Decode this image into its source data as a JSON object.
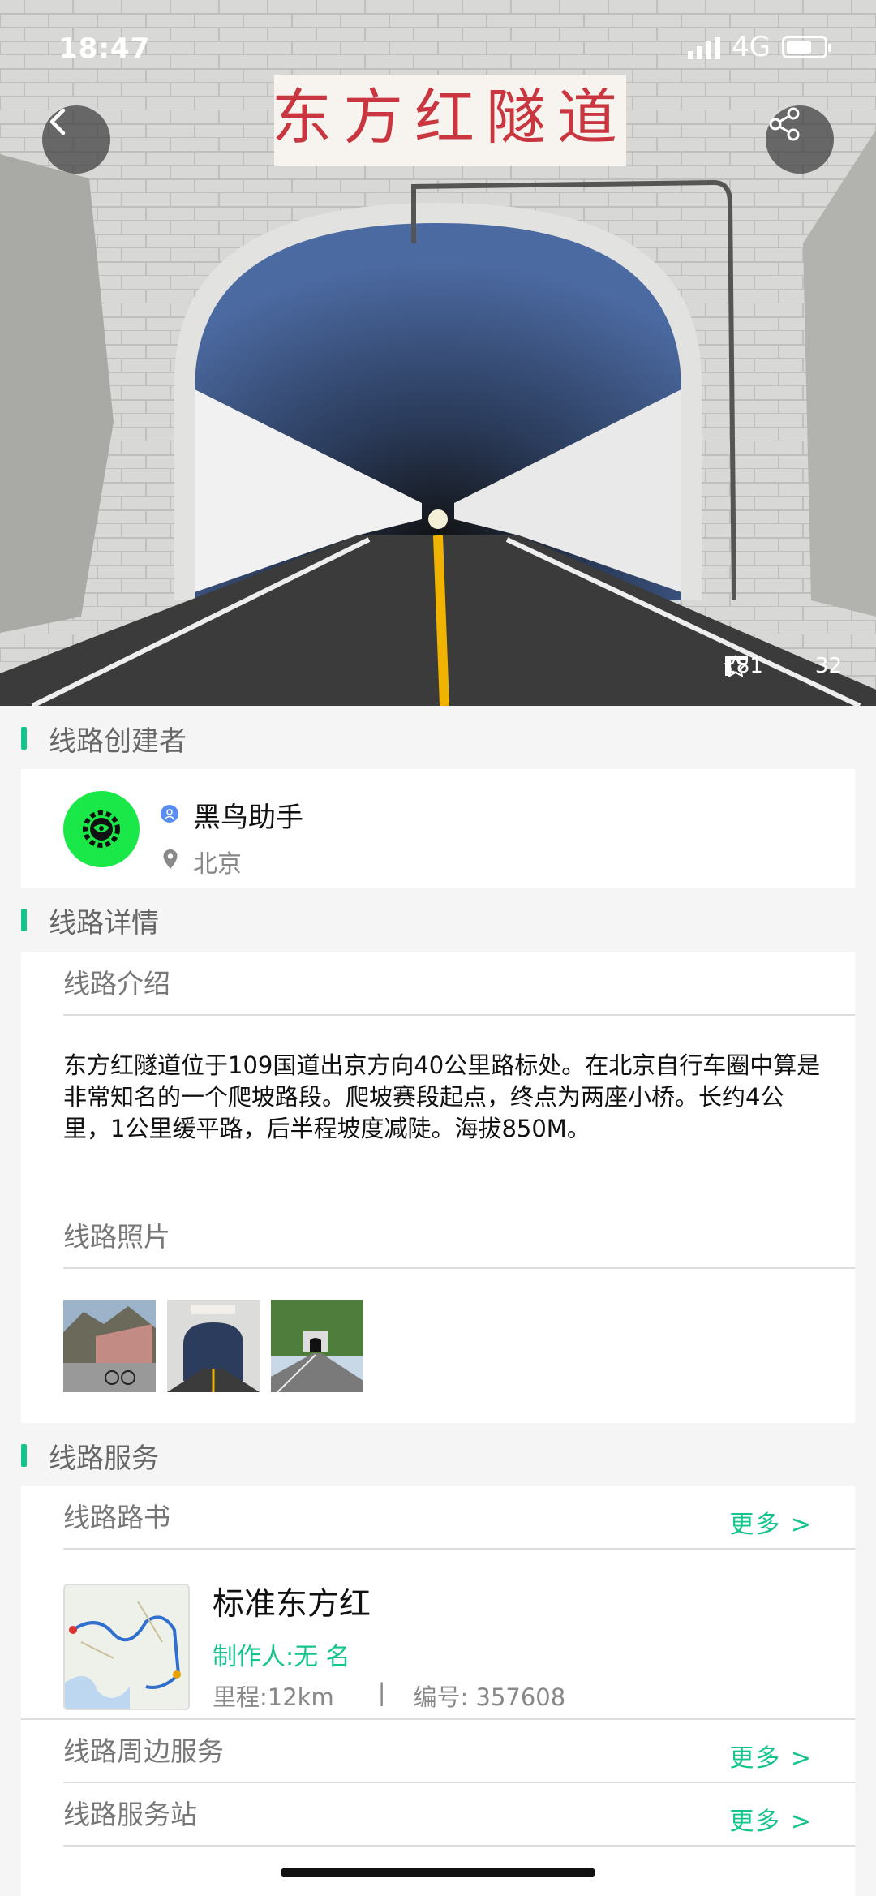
{
  "status_bar": {
    "time": "18:47",
    "network": "4G"
  },
  "hero": {
    "sign_text": "东方红隧道",
    "stats": {
      "favorites": "181",
      "comments": "32"
    }
  },
  "creator_section": {
    "title": "线路创建者",
    "name": "黑鸟助手",
    "location": "北京"
  },
  "details_section": {
    "title": "线路详情",
    "intro_title": "线路介绍",
    "intro_text": "东方红隧道位于109国道出京方向40公里路标处。在北京自行车圈中算是非常知名的一个爬坡路段。爬坡赛段起点，终点为两座小桥。长约4公里，1公里缓平路，后半程坡度减陡。海拔850M。",
    "photos_title": "线路照片",
    "photos": [
      "photo-mountain-road",
      "photo-tunnel",
      "photo-tunnel-far"
    ]
  },
  "services_section": {
    "title": "线路服务",
    "roadbook": {
      "title": "线路路书",
      "more": "更多 >",
      "name": "标准东方红",
      "maker": "制作人:无 名",
      "distance": "里程:12km",
      "separator": "|",
      "number": "编号: 357608"
    },
    "nearby": {
      "title": "线路周边服务",
      "more": "更多 >"
    },
    "stations": {
      "title": "线路服务站",
      "more": "更多 >"
    }
  },
  "colors": {
    "accent": "#14c48c",
    "avatar_bg": "#19e848"
  },
  "icons": [
    "back-icon",
    "share-icon",
    "star-icon",
    "comment-icon",
    "person-icon",
    "location-pin-icon",
    "creator-logo-icon"
  ]
}
